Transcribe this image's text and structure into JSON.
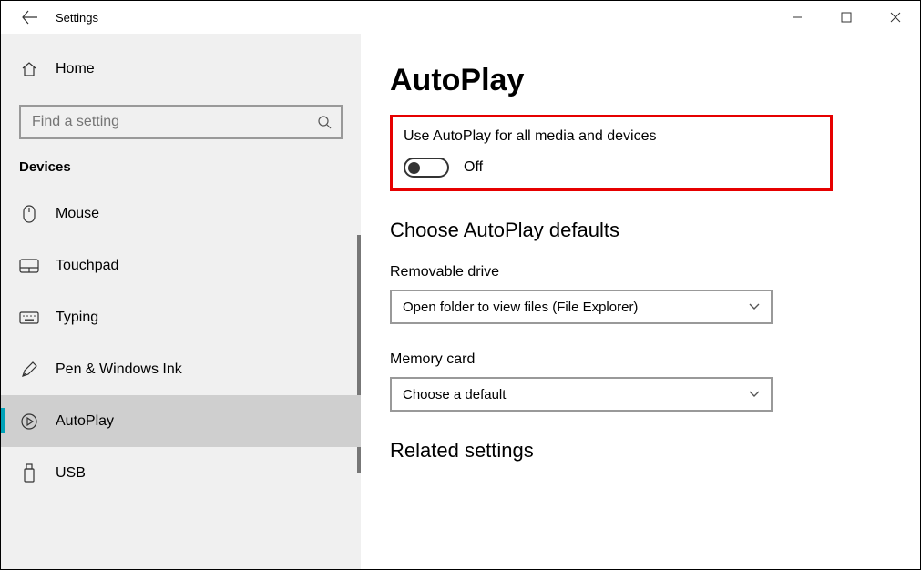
{
  "titlebar": {
    "title": "Settings"
  },
  "sidebar": {
    "home": "Home",
    "search_placeholder": "Find a setting",
    "heading": "Devices",
    "items": [
      {
        "label": "Mouse"
      },
      {
        "label": "Touchpad"
      },
      {
        "label": "Typing"
      },
      {
        "label": "Pen & Windows Ink"
      },
      {
        "label": "AutoPlay"
      },
      {
        "label": "USB"
      }
    ]
  },
  "main": {
    "title": "AutoPlay",
    "toggle_caption": "Use AutoPlay for all media and devices",
    "toggle_state": "Off",
    "section1": "Choose AutoPlay defaults",
    "removable_label": "Removable drive",
    "removable_value": "Open folder to view files (File Explorer)",
    "memory_label": "Memory card",
    "memory_value": "Choose a default",
    "section2": "Related settings"
  }
}
